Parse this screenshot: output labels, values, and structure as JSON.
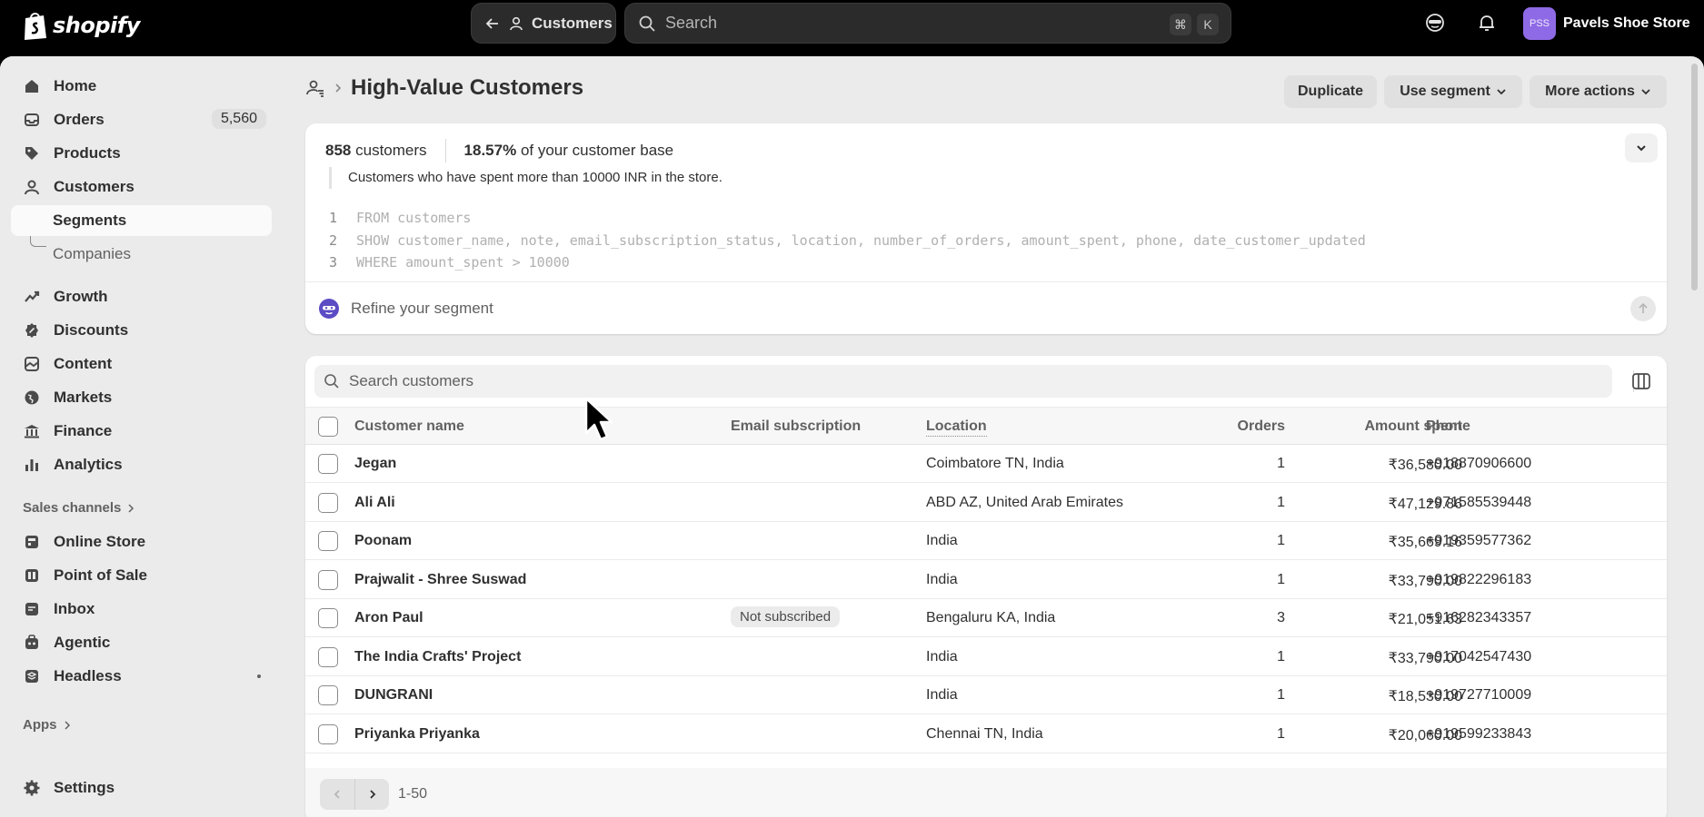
{
  "topbar": {
    "logo_text": "shopify",
    "back_label": "Customers",
    "search_placeholder": "Search",
    "shortcut_keys": [
      "⌘",
      "K"
    ],
    "store_initials": "PSS",
    "store_name": "Pavels Shoe Store"
  },
  "sidebar": {
    "items": [
      {
        "label": "Home",
        "icon": "home-icon"
      },
      {
        "label": "Orders",
        "icon": "inbox-icon",
        "badge": "5,560"
      },
      {
        "label": "Products",
        "icon": "tag-icon"
      },
      {
        "label": "Customers",
        "icon": "person-icon"
      },
      {
        "label": "Segments",
        "active": true
      },
      {
        "label": "Companies"
      },
      {
        "label": "Growth",
        "icon": "chart-line-icon"
      },
      {
        "label": "Discounts",
        "icon": "discount-icon"
      },
      {
        "label": "Content",
        "icon": "content-icon"
      },
      {
        "label": "Markets",
        "icon": "globe-icon"
      },
      {
        "label": "Finance",
        "icon": "bank-icon"
      },
      {
        "label": "Analytics",
        "icon": "bar-chart-icon"
      }
    ],
    "sales_channels_label": "Sales channels",
    "channels": [
      {
        "label": "Online Store",
        "icon": "store-icon"
      },
      {
        "label": "Point of Sale",
        "icon": "pos-icon"
      },
      {
        "label": "Inbox",
        "icon": "chat-icon"
      },
      {
        "label": "Agentic",
        "icon": "agent-icon"
      },
      {
        "label": "Headless",
        "icon": "headless-icon"
      }
    ],
    "apps_label": "Apps",
    "settings_label": "Settings"
  },
  "page": {
    "title": "High-Value Customers",
    "buttons": {
      "duplicate": "Duplicate",
      "use_segment": "Use segment",
      "more_actions": "More actions"
    }
  },
  "segment": {
    "count": "858",
    "count_suffix": "customers",
    "percent": "18.57%",
    "percent_suffix": "of your customer base",
    "description": "Customers who have spent more than 10000 INR in the store.",
    "query_lines": [
      {
        "n": "1",
        "text": "FROM customers"
      },
      {
        "n": "2",
        "text": "SHOW customer_name, note, email_subscription_status, location, number_of_orders, amount_spent, phone, date_customer_updated"
      },
      {
        "n": "3",
        "text": "WHERE amount_spent > 10000"
      }
    ],
    "refine_placeholder": "Refine your segment"
  },
  "table": {
    "search_placeholder": "Search customers",
    "headers": {
      "name": "Customer name",
      "email": "Email subscription",
      "location": "Location",
      "orders": "Orders",
      "amount": "Amount spent",
      "phone": "Phone"
    },
    "rows": [
      {
        "name": "Jegan",
        "email": "",
        "location": "Coimbatore TN, India",
        "orders": "1",
        "amount": "₹36,580.00",
        "phone": "+918870906600"
      },
      {
        "name": "Ali Ali",
        "email": "",
        "location": "ABD AZ, United Arab Emirates",
        "orders": "1",
        "amount": "₹47,129.86",
        "phone": "+971585539448"
      },
      {
        "name": "Poonam",
        "email": "",
        "location": "India",
        "orders": "1",
        "amount": "₹35,669.16",
        "phone": "+919359577362"
      },
      {
        "name": "Prajwalit - Shree Suswad",
        "email": "",
        "location": "India",
        "orders": "1",
        "amount": "₹33,790.00",
        "phone": "+919822296183"
      },
      {
        "name": "Aron Paul",
        "email": "Not subscribed",
        "location": "Bengaluru KA, India",
        "orders": "3",
        "amount": "₹21,051.63",
        "phone": "+916282343357"
      },
      {
        "name": "The India Crafts' Project",
        "email": "",
        "location": "India",
        "orders": "1",
        "amount": "₹33,790.00",
        "phone": "+917042547430"
      },
      {
        "name": "DUNGRANI",
        "email": "",
        "location": "India",
        "orders": "1",
        "amount": "₹18,530.00",
        "phone": "+919727710009"
      },
      {
        "name": "Priyanka Priyanka",
        "email": "",
        "location": "Chennai TN, India",
        "orders": "1",
        "amount": "₹20,060.00",
        "phone": "+919599233843"
      }
    ],
    "pagination_label": "1-50"
  }
}
